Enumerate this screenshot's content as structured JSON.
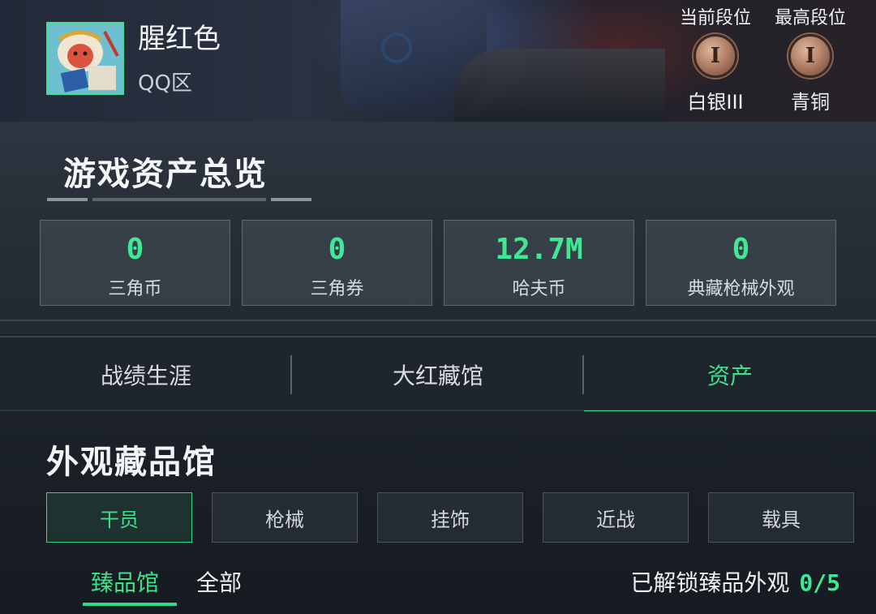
{
  "profile": {
    "nickname": "腥红色",
    "region": "QQ区",
    "avatar_icon": "monkey-king-reading-avatar"
  },
  "ranks": {
    "current_label": "当前段位",
    "highest_label": "最高段位",
    "current_value": "白银III",
    "highest_value": "青铜",
    "current_badge_glyph": "I",
    "highest_badge_glyph": "I"
  },
  "overview": {
    "title": "游戏资产总览",
    "cards": [
      {
        "value": "0",
        "label": "三角币"
      },
      {
        "value": "0",
        "label": "三角券"
      },
      {
        "value": "12.7M",
        "label": "哈夫币"
      },
      {
        "value": "0",
        "label": "典藏枪械外观"
      }
    ]
  },
  "tabs": [
    {
      "label": "战绩生涯",
      "active": false
    },
    {
      "label": "大红藏馆",
      "active": false
    },
    {
      "label": "资产",
      "active": true
    }
  ],
  "collection": {
    "title": "外观藏品馆",
    "filters": [
      {
        "label": "干员",
        "active": true
      },
      {
        "label": "枪械",
        "active": false
      },
      {
        "label": "挂饰",
        "active": false
      },
      {
        "label": "近战",
        "active": false
      },
      {
        "label": "载具",
        "active": false
      }
    ],
    "subtabs": [
      {
        "label": "臻品馆",
        "active": true
      },
      {
        "label": "全部",
        "active": false
      }
    ],
    "unlock_label": "已解锁臻品外观",
    "unlock_value": "0/5"
  },
  "colors": {
    "accent": "#3ee08a",
    "value_green": "#3ee895"
  }
}
